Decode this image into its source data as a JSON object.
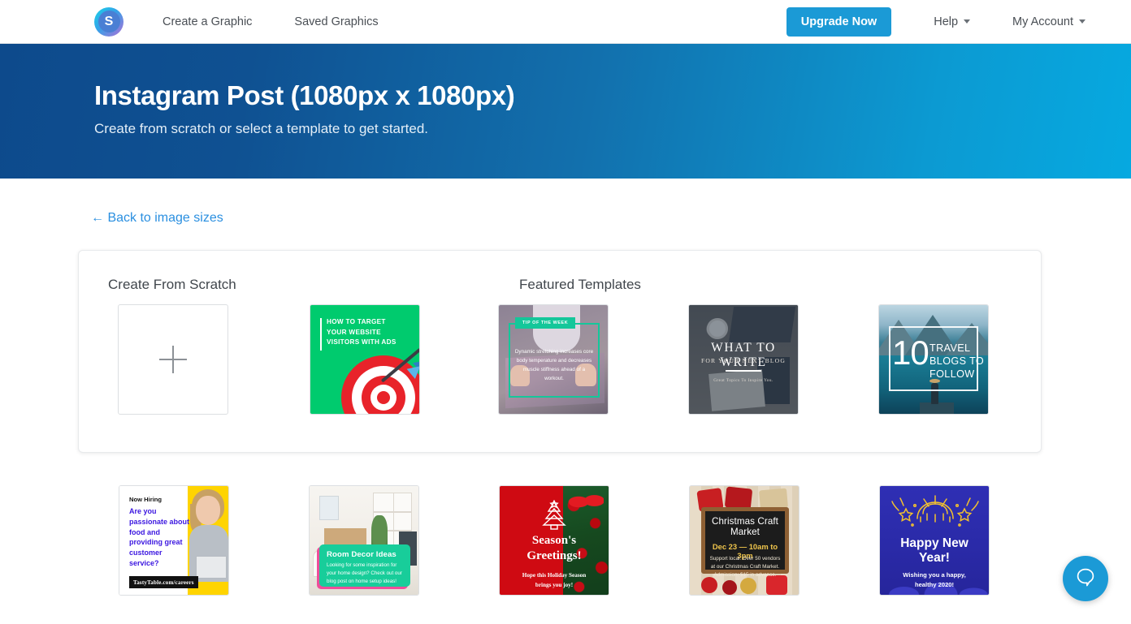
{
  "header": {
    "logo_letter": "S",
    "nav": [
      {
        "label": "Create a Graphic"
      },
      {
        "label": "Saved Graphics"
      }
    ],
    "upgrade_label": "Upgrade Now",
    "help_label": "Help",
    "account_label": "My Account",
    "accent_color": "#1b9ad6"
  },
  "hero": {
    "title": "Instagram Post (1080px x 1080px)",
    "subtitle": "Create from scratch or select a template to get started.",
    "gradient_from": "#0d4a8c",
    "gradient_to": "#06a9e0"
  },
  "back_link": "← Back to image sizes",
  "panel": {
    "scratch_label": "Create From Scratch",
    "featured_label": "Featured Templates",
    "scratch_tile": {
      "icon": "plus-icon"
    }
  },
  "templates": {
    "ads": {
      "line1": "HOW TO TARGET",
      "line2": "YOUR WEBSITE",
      "line3": "VISITORS WITH ADS",
      "bg": "#00cb6e"
    },
    "tip": {
      "badge": "TIP OF THE WEEK",
      "body": "Dynamic stretching increases core body temperature and decreases muscle stiffness ahead of a workout.",
      "accent": "#14c79a"
    },
    "write": {
      "title": "WHAT TO WRITE",
      "subtitle": "FOR YOUR NEXT BLOG",
      "footer": "Great Topics To Inspire You."
    },
    "travel": {
      "number": "10",
      "line1": "TRAVEL",
      "line2": "BLOGS TO",
      "line3": "FOLLOW"
    },
    "hiring": {
      "kicker": "Now Hiring",
      "headline": "Are you passionate about food and providing great customer service?",
      "url": "TastyTable.com/careers",
      "headline_color": "#3b16e0"
    },
    "decor": {
      "title": "Room Decor Ideas",
      "body": "Looking for some inspiration for your home design? Check out our blog post on home setup ideas!",
      "accent": "#18cd9a"
    },
    "season": {
      "line1": "Season's",
      "line2": "Greetings!",
      "body1": "Hope this Holiday Season",
      "body2": "brings you joy!",
      "bg": "#cf0a12"
    },
    "craft": {
      "title1": "Christmas Craft",
      "title2": "Market",
      "date": "Dec 23 — 10am to 3pm",
      "body": "Support local. Over 50 vendors at our Christmas Craft Market. Admission: $15 in advance.",
      "date_color": "#efc54c"
    },
    "newyear": {
      "line1": "Happy New",
      "line2": "Year!",
      "body1": "Wishing you a happy,",
      "body2": "healthy 2020!",
      "bg": "#2f2fb4"
    }
  },
  "chat": {
    "icon": "chat-bubble-icon"
  }
}
